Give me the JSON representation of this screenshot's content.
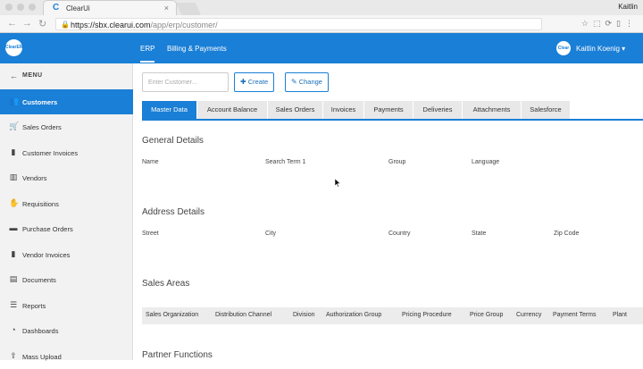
{
  "browser": {
    "tab_title": "ClearUi",
    "tab_close": "×",
    "user": "Kaitlin",
    "url_host": "https://sbx.clearui.com",
    "url_path": "/app/erp/customer/"
  },
  "header": {
    "brand": "ClearERP",
    "links": [
      "ERP",
      "Billing & Payments"
    ],
    "user_brand": "Clear",
    "user_name": "Kaitlin Koenig ▾"
  },
  "sidebar": {
    "menu_label": "MENU",
    "items": [
      {
        "label": "Customers",
        "icon": "users-icon",
        "glyph": "👥"
      },
      {
        "label": "Sales Orders",
        "icon": "cart-icon",
        "glyph": "🛒"
      },
      {
        "label": "Customer Invoices",
        "icon": "file-icon",
        "glyph": "▮"
      },
      {
        "label": "Vendors",
        "icon": "building-icon",
        "glyph": "▥"
      },
      {
        "label": "Requisitions",
        "icon": "hand-icon",
        "glyph": "✋"
      },
      {
        "label": "Purchase Orders",
        "icon": "truck-icon",
        "glyph": "▬"
      },
      {
        "label": "Vendor Invoices",
        "icon": "file-icon",
        "glyph": "▮"
      },
      {
        "label": "Documents",
        "icon": "document-icon",
        "glyph": "▤"
      },
      {
        "label": "Reports",
        "icon": "list-icon",
        "glyph": "☰"
      },
      {
        "label": "Dashboards",
        "icon": "dashboard-icon",
        "glyph": "◔"
      },
      {
        "label": "Mass Upload",
        "icon": "upload-icon",
        "glyph": "⇪"
      }
    ]
  },
  "toolbar": {
    "customer_placeholder": "Enter Customer...",
    "create_label": "Create",
    "change_label": "Change"
  },
  "tabs": [
    "Master Data",
    "Account Balance",
    "Sales Orders",
    "Invoices",
    "Payments",
    "Deliveries",
    "Attachments",
    "Salesforce"
  ],
  "general": {
    "title": "General Details",
    "fields": [
      "Name",
      "Search Term 1",
      "Group",
      "Language"
    ]
  },
  "address": {
    "title": "Address Details",
    "fields": [
      "Street",
      "City",
      "Country",
      "State",
      "Zip Code"
    ]
  },
  "sales_areas": {
    "title": "Sales Areas",
    "columns": [
      "Sales Organization",
      "Distribution Channel",
      "Division",
      "Authorization Group",
      "Pricing Procedure",
      "Price Group",
      "Currency",
      "Payment Terms",
      "Plant"
    ]
  },
  "partner": {
    "title": "Partner Functions"
  },
  "colors": {
    "primary": "#1a7fd6"
  }
}
